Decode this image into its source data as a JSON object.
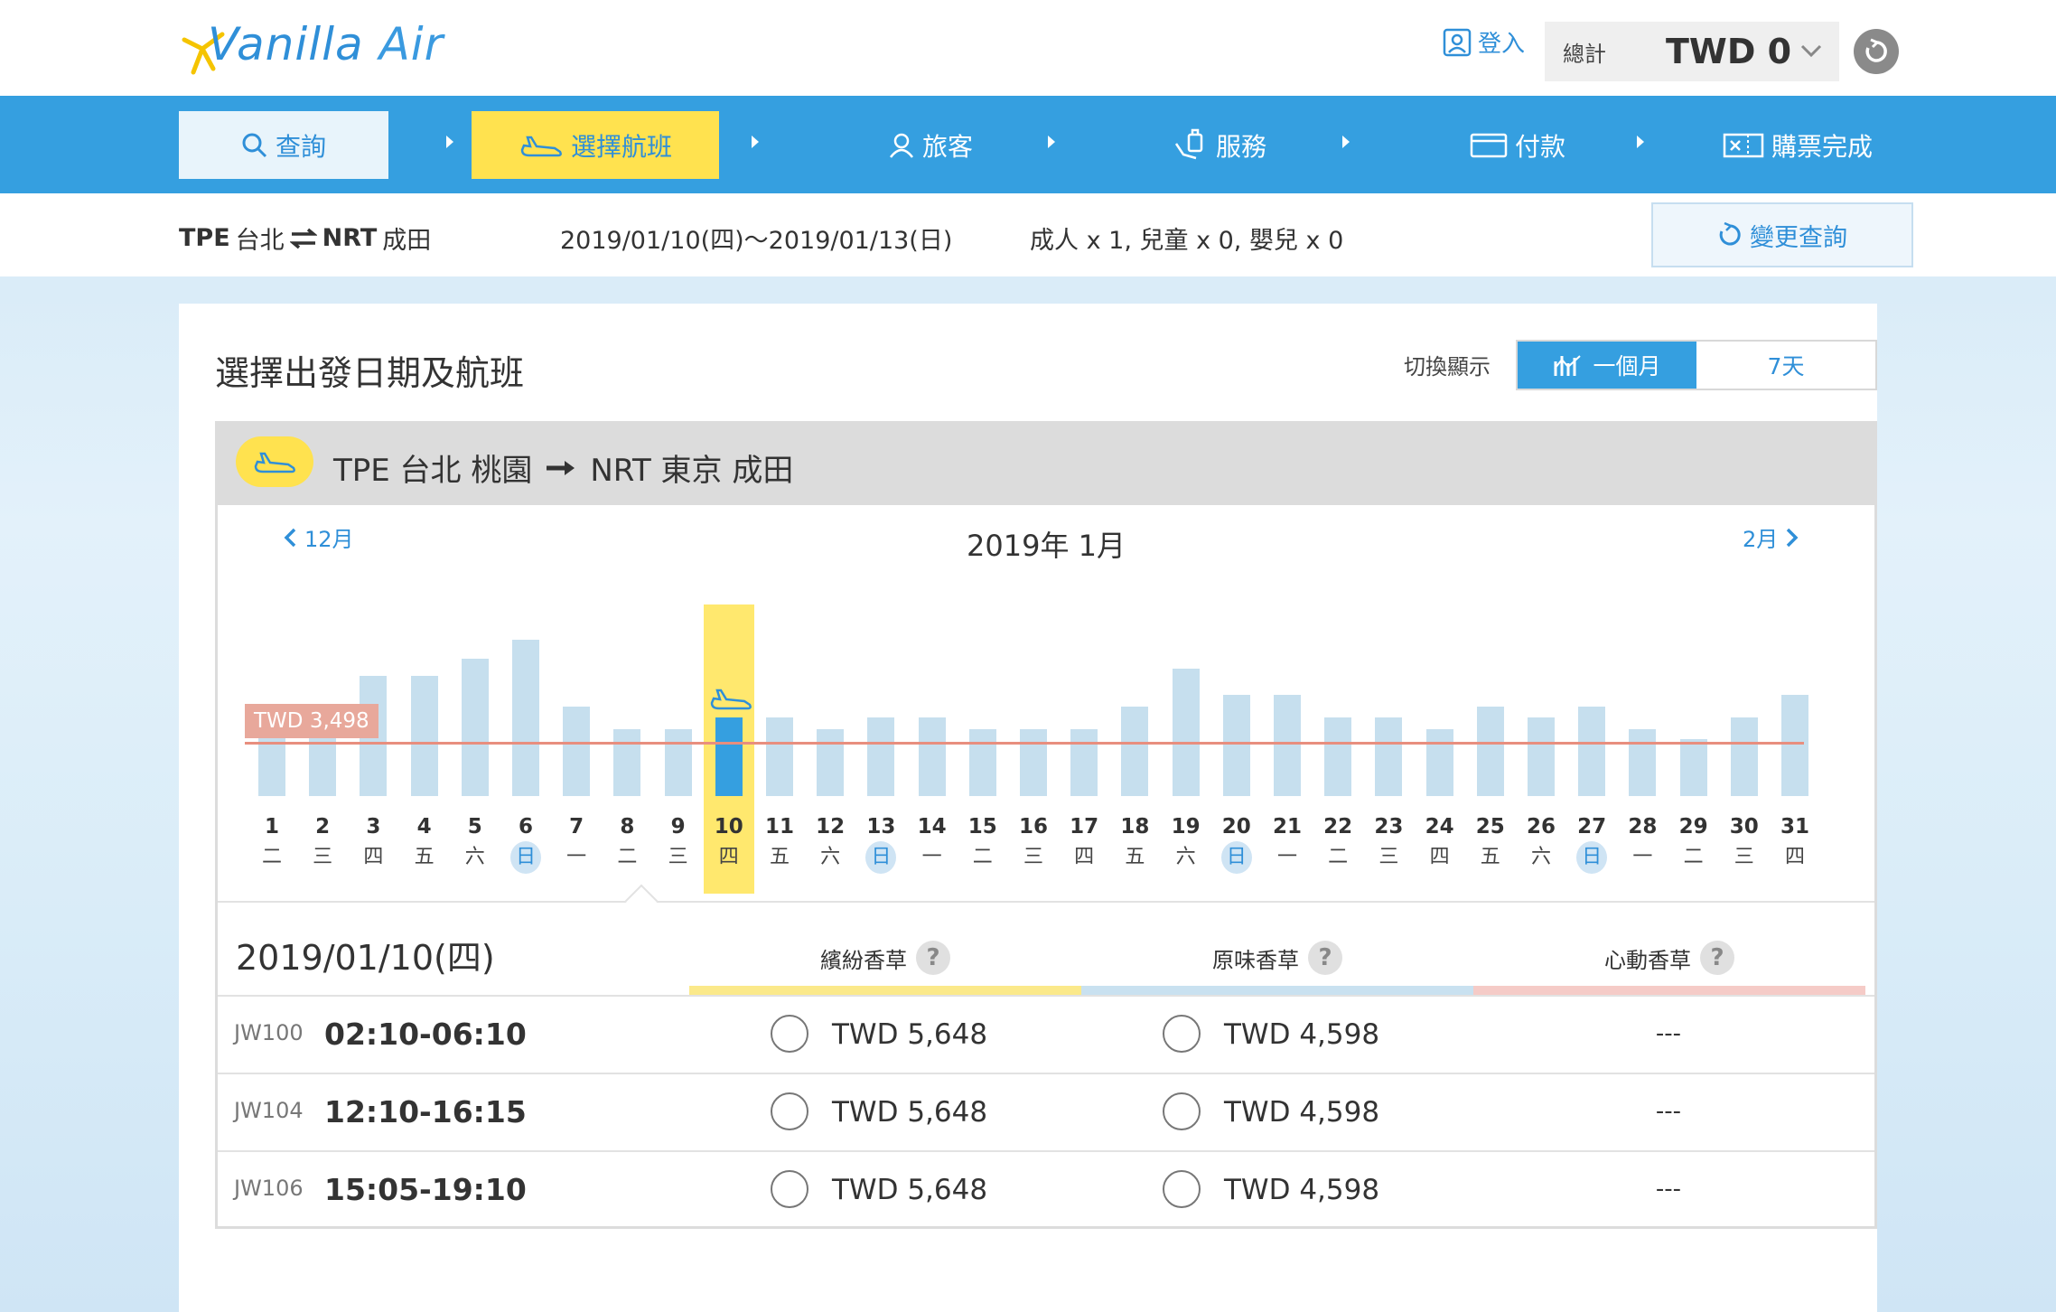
{
  "header": {
    "logo_text_1": "Vanilla",
    "logo_text_2": "Air",
    "login_label": "登入",
    "total_label": "總計",
    "total_value": "TWD 0"
  },
  "steps": [
    {
      "label": "查詢",
      "icon": "search-icon"
    },
    {
      "label": "選擇航班",
      "icon": "plane-icon"
    },
    {
      "label": "旅客",
      "icon": "person-icon"
    },
    {
      "label": "服務",
      "icon": "luggage-icon"
    },
    {
      "label": "付款",
      "icon": "card-icon"
    },
    {
      "label": "購票完成",
      "icon": "ticket-icon"
    }
  ],
  "summary": {
    "origin_code": "TPE",
    "origin_name": "台北",
    "dest_code": "NRT",
    "dest_name": "成田",
    "dates": "2019/01/10(四)～2019/01/13(日)",
    "passengers": "成人 x 1,  兒童 x 0,  嬰兒 x 0",
    "change_label": "變更查詢"
  },
  "panel": {
    "title": "選擇出發日期及航班",
    "toggle_label": "切換顯示",
    "toggle_month": "一個月",
    "toggle_week": "7天"
  },
  "route": {
    "from": "TPE  台北 桃園",
    "to": "NRT  東京 成田"
  },
  "calendar": {
    "prev_month": "12月",
    "next_month": "2月",
    "month_title": "2019年 1月",
    "min_price_label": "TWD 3,498",
    "selected_day": 10,
    "days": [
      {
        "d": "1",
        "w": "二",
        "h": 0.36
      },
      {
        "d": "2",
        "w": "三",
        "h": 0.36
      },
      {
        "d": "3",
        "w": "四",
        "h": 0.7
      },
      {
        "d": "4",
        "w": "五",
        "h": 0.7
      },
      {
        "d": "5",
        "w": "六",
        "h": 0.8
      },
      {
        "d": "6",
        "w": "日",
        "h": 0.91,
        "sun": true
      },
      {
        "d": "7",
        "w": "一",
        "h": 0.52
      },
      {
        "d": "8",
        "w": "二",
        "h": 0.39
      },
      {
        "d": "9",
        "w": "三",
        "h": 0.39
      },
      {
        "d": "10",
        "w": "四",
        "h": 0.46
      },
      {
        "d": "11",
        "w": "五",
        "h": 0.46
      },
      {
        "d": "12",
        "w": "六",
        "h": 0.39
      },
      {
        "d": "13",
        "w": "日",
        "h": 0.46,
        "sun": true
      },
      {
        "d": "14",
        "w": "一",
        "h": 0.46
      },
      {
        "d": "15",
        "w": "二",
        "h": 0.39
      },
      {
        "d": "16",
        "w": "三",
        "h": 0.39
      },
      {
        "d": "17",
        "w": "四",
        "h": 0.39
      },
      {
        "d": "18",
        "w": "五",
        "h": 0.52
      },
      {
        "d": "19",
        "w": "六",
        "h": 0.74
      },
      {
        "d": "20",
        "w": "日",
        "h": 0.59,
        "sun": true
      },
      {
        "d": "21",
        "w": "一",
        "h": 0.59
      },
      {
        "d": "22",
        "w": "二",
        "h": 0.46
      },
      {
        "d": "23",
        "w": "三",
        "h": 0.46
      },
      {
        "d": "24",
        "w": "四",
        "h": 0.39
      },
      {
        "d": "25",
        "w": "五",
        "h": 0.52
      },
      {
        "d": "26",
        "w": "六",
        "h": 0.46
      },
      {
        "d": "27",
        "w": "日",
        "h": 0.52,
        "sun": true
      },
      {
        "d": "28",
        "w": "一",
        "h": 0.39
      },
      {
        "d": "29",
        "w": "二",
        "h": 0.33
      },
      {
        "d": "30",
        "w": "三",
        "h": 0.46
      },
      {
        "d": "31",
        "w": "四",
        "h": 0.59
      }
    ]
  },
  "fares": {
    "selected_date": "2019/01/10(四)",
    "types": [
      {
        "name": "繽紛香草",
        "color": "#fbe98a"
      },
      {
        "name": "原味香草",
        "color": "#c9e1f0"
      },
      {
        "name": "心動香草",
        "color": "#f5cbc7"
      }
    ],
    "help_glyph": "?",
    "flights": [
      {
        "no": "JW100",
        "time": "02:10-06:10",
        "p1": "TWD 5,648",
        "p2": "TWD 4,598",
        "p3": "---"
      },
      {
        "no": "JW104",
        "time": "12:10-16:15",
        "p1": "TWD 5,648",
        "p2": "TWD 4,598",
        "p3": "---"
      },
      {
        "no": "JW106",
        "time": "15:05-19:10",
        "p1": "TWD 5,648",
        "p2": "TWD 4,598",
        "p3": "---"
      }
    ]
  }
}
